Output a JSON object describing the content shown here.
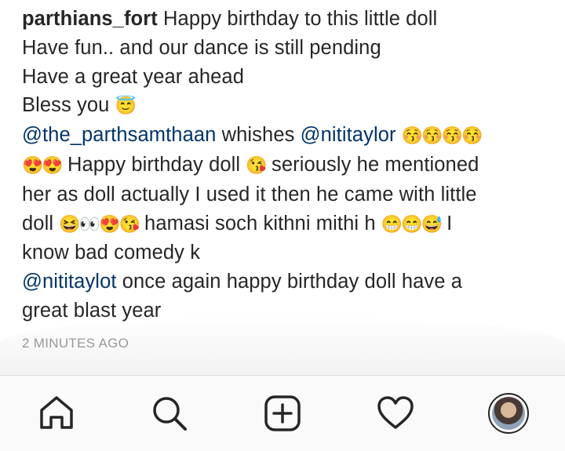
{
  "comment": {
    "username": "parthians_fort",
    "line1_text": " Happy birthday to this  little doll",
    "line2": "Have fun.. and our dance is still pending",
    "line3": "Have a great year ahead",
    "line4_text": "Bless you ",
    "line4_emoji": "😇",
    "mention_parth": "@the_parthsamthaan",
    "wishes_text": "  whishes ",
    "mention_niti": "@nititaylor",
    "kiss_emojis": "😚😚😚😚",
    "heart_eyes": "😍😍",
    "happy_text": " Happy birthday doll ",
    "blow_kiss_emoji": "😘",
    "seriously_text": " seriously he mentioned",
    "line7": "her as doll actually I used it then he came with little",
    "doll_text": "doll ",
    "mixed_emojis": "😆👀😍😘",
    "hamasi_text": " hamasi soch kithni mithi h ",
    "laugh_emojis": "😁😁😅",
    "i_text": " I",
    "line9": "know bad comedy k",
    "mention_nitit": "@nititaylot",
    "once_text": " once again happy birthday doll have a",
    "line11": "great blast year"
  },
  "timestamp": "2 MINUTES AGO",
  "nav": {
    "icons": [
      "home-icon",
      "search-icon",
      "add-post-icon",
      "heart-icon",
      "profile-avatar"
    ]
  },
  "colors": {
    "mention": "#003569",
    "timestamp": "#999999",
    "text": "#262626"
  }
}
